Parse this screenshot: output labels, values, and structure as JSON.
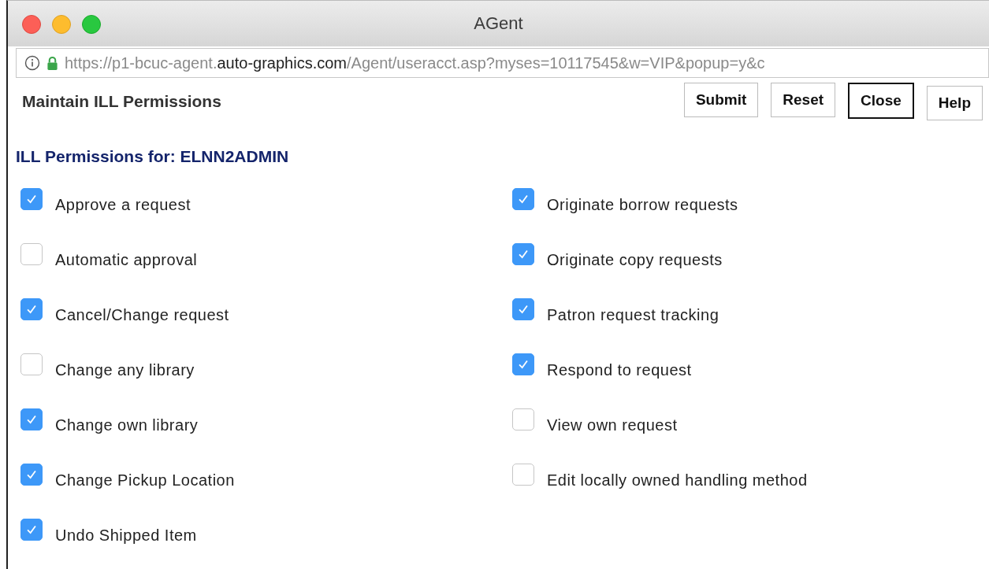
{
  "window": {
    "title": "AGent"
  },
  "address_bar": {
    "url_start": "https://p1-bcuc-agent.",
    "url_domain": "auto-graphics.com",
    "url_end": "/Agent/useracct.asp?myses=10117545&w=VIP&popup=y&c"
  },
  "page": {
    "title": "Maintain ILL Permissions",
    "buttons": [
      {
        "label": "Submit",
        "focused": false
      },
      {
        "label": "Reset",
        "focused": false
      },
      {
        "label": "Close",
        "focused": true
      },
      {
        "label": "Help",
        "focused": false
      }
    ]
  },
  "section": {
    "heading": "ILL Permissions for: ELNN2ADMIN"
  },
  "columns": [
    {
      "items": [
        {
          "label": "Approve a request",
          "checked": true
        },
        {
          "label": "Automatic approval",
          "checked": false
        },
        {
          "label": "Cancel/Change request",
          "checked": true
        },
        {
          "label": "Change any library",
          "checked": false
        },
        {
          "label": "Change own library",
          "checked": true
        },
        {
          "label": "Change Pickup Location",
          "checked": true
        },
        {
          "label": "Undo Shipped Item",
          "checked": true
        }
      ]
    },
    {
      "items": [
        {
          "label": "Originate borrow requests",
          "checked": true
        },
        {
          "label": "Originate copy requests",
          "checked": true
        },
        {
          "label": "Patron request tracking",
          "checked": true
        },
        {
          "label": "Respond to request",
          "checked": true
        },
        {
          "label": "View own request",
          "checked": false
        },
        {
          "label": "Edit locally owned handling method",
          "checked": false
        }
      ]
    }
  ]
}
